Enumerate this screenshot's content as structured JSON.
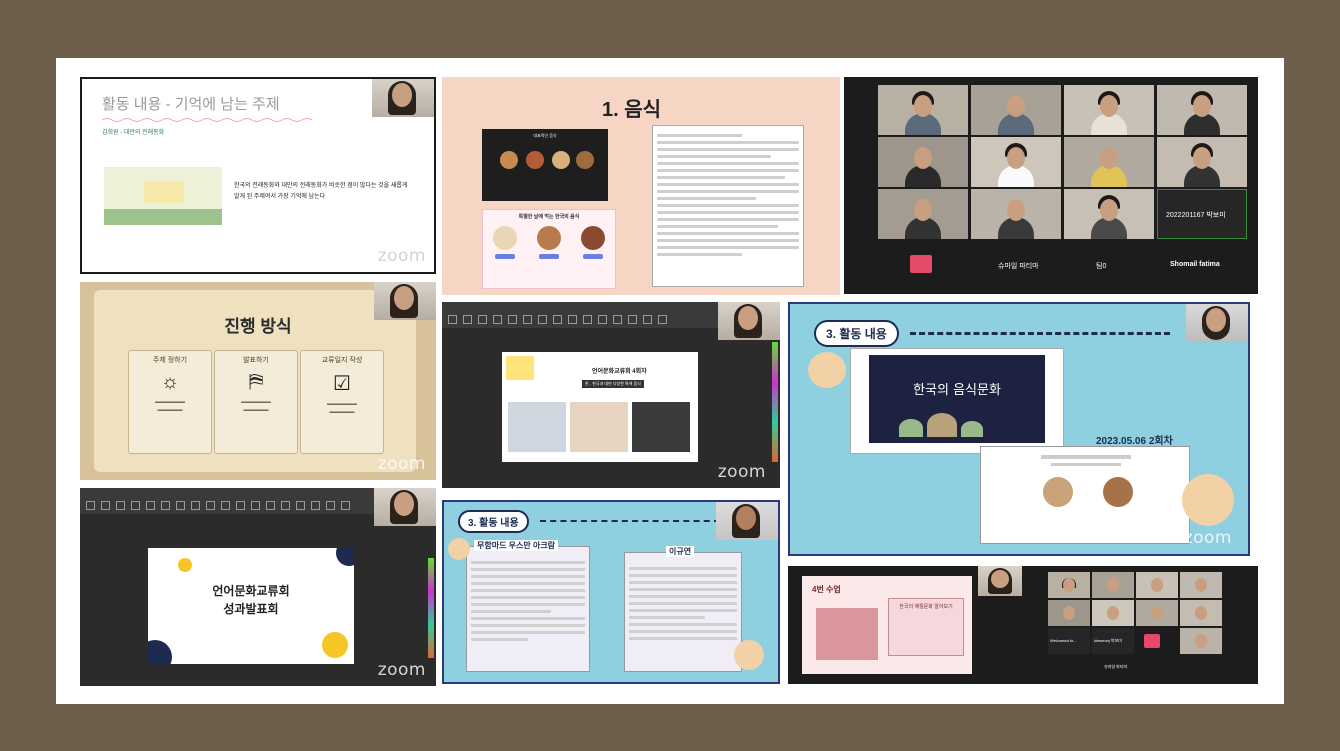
{
  "colors": {
    "frame": "#6e5f4c",
    "sheet": "#ffffff",
    "navy": "#1d2b53",
    "sky": "#8ecfe0"
  },
  "watermark": "zoom",
  "panel1": {
    "title": "활동 내용 - 기억에 남는 주제",
    "subtitle": "김희원 - 대만의 전래동화",
    "body": "한국의 전래동화와 대만의 전래동화가 비슷한 점이 많다는 것을 새롭게 알게 된 주제여서 가장 기억에 남는다"
  },
  "panel2": {
    "title": "1. 음식",
    "slide_a_title": "대표적인 음식",
    "slide_b_title": "특별한 날에 먹는 한국의 음식"
  },
  "panel3": {
    "names": [
      "2022201167 박보미",
      "Shomail fatima",
      "슈마일 파티마",
      "팀0"
    ]
  },
  "panel4": {
    "title": "진행 방식",
    "cols": [
      "주제 정하기",
      "발표하기",
      "교류일지 작성"
    ]
  },
  "panel5": {
    "title": "언어문화교류회 4회차",
    "subtitle": "한 - 한국과 대만 다양한 특색 음식"
  },
  "panel6": {
    "heading": "3. 활동 내용",
    "slide_title": "한국의 음식문화",
    "date": "2023.05.06 2회차"
  },
  "panel7": {
    "title_line1": "언어문화교류회",
    "title_line2": "성과발표회"
  },
  "panel8": {
    "heading": "3. 활동 내용",
    "left_name": "무함마드 우스만 아크람",
    "right_name": "이규연"
  },
  "panel9": {
    "title": "4번 수업",
    "slide_title": "한국의 예절문화 알아보기"
  },
  "panel10": {
    "names": [
      "Welcomed to...",
      "kimseonj 박보미",
      "슈마일 파티마"
    ]
  }
}
